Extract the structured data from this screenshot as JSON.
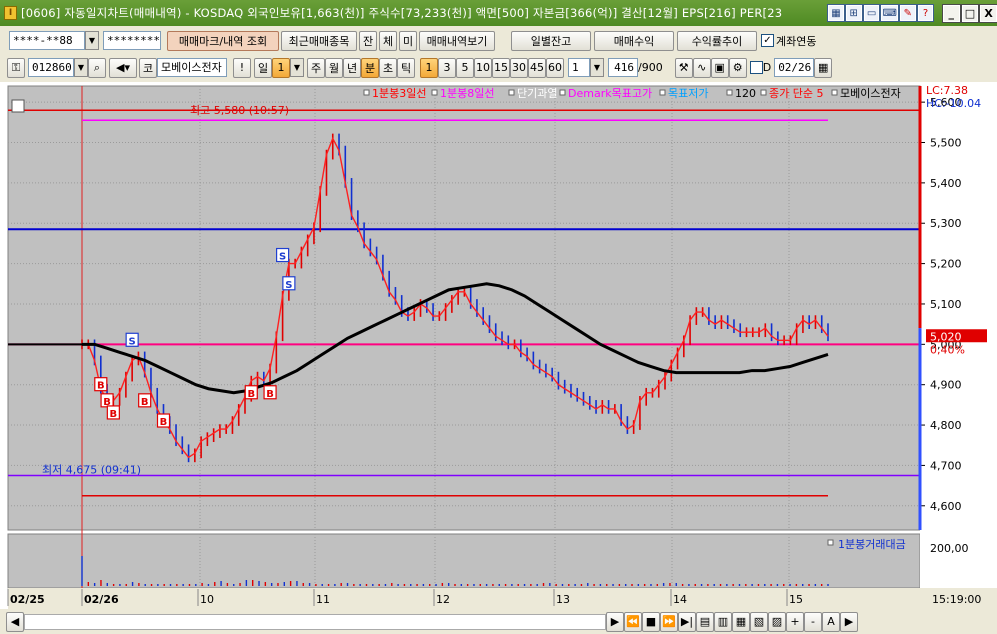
{
  "window": {
    "title": "[0606] 자동일지차트(매매내역) - KOSDAQ 외국인보유[1,663(천)] 주식수[73,233(천)] 액면[500] 자본금[366(억)] 결산[12월] EPS[216] PER[23",
    "app_icon": "I",
    "title_icons": [
      "layout-icon",
      "link-icon",
      "window-icon",
      "keyboard-icon",
      "pen-icon",
      "help-icon"
    ],
    "help_label": "?",
    "minimize_label": "_",
    "maximize_label": "□",
    "close_label": "X"
  },
  "toolbar1": {
    "account": "****-**88",
    "password": "********",
    "trade_mark_button": "매매마크/내역 조회",
    "recent_items_button": "최근매매종목",
    "balance_toggle": "잔",
    "fill_toggle": "체",
    "unfilled_toggle": "미",
    "view_history_button": "매매내역보기",
    "daily_balance_button": "일별잔고",
    "trade_profit_button": "매매수익",
    "return_trend_button": "수익률추이",
    "account_link_label": "계좌연동",
    "account_link_checked": "✓"
  },
  "toolbar2": {
    "stock_code": "012860",
    "market_label": "코",
    "stock_name": "모베이스전자",
    "alert_label": "!",
    "period_day": "일",
    "period_value": "1",
    "period_week": "주",
    "period_month": "월",
    "period_year": "년",
    "period_minute": "분",
    "period_second": "초",
    "period_tick": "틱",
    "intervals": [
      "1",
      "3",
      "5",
      "10",
      "15",
      "30",
      "45",
      "60"
    ],
    "interval_active": "1",
    "interval_custom": "1",
    "count_display": "416",
    "count_total": "/900",
    "d_label": "D",
    "date_value": "02/26"
  },
  "chart_data": {
    "type": "line",
    "subtype": "1-minute candlestick with moving averages",
    "legend": [
      {
        "label": "1분봉3일선",
        "color": "#ff0000"
      },
      {
        "label": "1분봉8일선",
        "color": "#ff00ff"
      },
      {
        "label": "단기과열",
        "color": "#ffffff"
      },
      {
        "label": "Demark목표고가",
        "color": "#ff00ff"
      },
      {
        "label": "목표저가",
        "color": "#00a0ff"
      },
      {
        "label": "120",
        "color": "#000000"
      },
      {
        "label": "종가 단순 5",
        "color": "#ff0000"
      },
      {
        "label": "모베이스전자",
        "color": "#000000"
      }
    ],
    "lc_label": "LC:7.38",
    "hc_label": "HC:-10.04",
    "ylim": [
      4540,
      5640
    ],
    "y_ticks": [
      5600,
      5500,
      5400,
      5300,
      5200,
      5100,
      5000,
      4900,
      4800,
      4700,
      4600
    ],
    "y_tick_labels": [
      "5,600",
      "5,500",
      "5,400",
      "5,300",
      "5,200",
      "5,100",
      "5,000",
      "4,900",
      "4,800",
      "4,700",
      "4,600"
    ],
    "current_price": 5020,
    "current_price_label": "5,020",
    "current_change_label": "0,40%",
    "high_annotation": "최고 5,580 (10:57)",
    "low_annotation": "최저 4,675 (09:41)",
    "lines": {
      "upper_red": 5580,
      "magenta": 5555,
      "blue": 5285,
      "pink": 5000,
      "purple": 4675,
      "lower_red": 4625
    },
    "x_labels": [
      "02/25",
      "02/26",
      "10",
      "11",
      "12",
      "13",
      "14",
      "15"
    ],
    "time_label": "15:19:00",
    "volume_legend": "1분봉거래대금",
    "volume_tick_label": "200,00",
    "price_series": [
      5000,
      5000,
      4960,
      4890,
      4860,
      4860,
      4880,
      4920,
      4960,
      4970,
      4930,
      4880,
      4840,
      4810,
      4790,
      4760,
      4740,
      4720,
      4730,
      4760,
      4770,
      4780,
      4790,
      4790,
      4810,
      4840,
      4870,
      4910,
      4920,
      4910,
      4940,
      5020,
      5120,
      5200,
      5200,
      5230,
      5260,
      5290,
      5380,
      5470,
      5510,
      5480,
      5400,
      5320,
      5290,
      5250,
      5230,
      5210,
      5170,
      5130,
      5110,
      5080,
      5070,
      5080,
      5100,
      5090,
      5070,
      5070,
      5090,
      5110,
      5130,
      5130,
      5100,
      5080,
      5060,
      5040,
      5020,
      5010,
      5000,
      5000,
      4980,
      4970,
      4950,
      4940,
      4930,
      4920,
      4900,
      4890,
      4880,
      4870,
      4860,
      4850,
      4840,
      4850,
      4840,
      4840,
      4810,
      4790,
      4800,
      4860,
      4880,
      4880,
      4900,
      4920,
      4950,
      4980,
      5010,
      5060,
      5080,
      5080,
      5060,
      5050,
      5060,
      5050,
      5040,
      5030,
      5030,
      5030,
      5030,
      5040,
      5020,
      5010,
      5010,
      5010,
      5040,
      5060,
      5050,
      5060,
      5040,
      5020
    ],
    "ma120_series": [
      5000,
      5000,
      4990,
      4980,
      4970,
      4960,
      4945,
      4930,
      4915,
      4900,
      4890,
      4885,
      4880,
      4885,
      4895,
      4905,
      4920,
      4935,
      4955,
      4975,
      4995,
      5015,
      5030,
      5045,
      5060,
      5075,
      5090,
      5105,
      5120,
      5135,
      5140,
      5145,
      5150,
      5145,
      5135,
      5120,
      5100,
      5080,
      5060,
      5040,
      5020,
      5000,
      4985,
      4970,
      4955,
      4945,
      4935,
      4930,
      4930,
      4930,
      4930,
      4930,
      4930,
      4935,
      4935,
      4940,
      4945,
      4955,
      4965,
      4975
    ],
    "markers": [
      {
        "t": "B",
        "i": 3,
        "v": 4900
      },
      {
        "t": "B",
        "i": 4,
        "v": 4860
      },
      {
        "t": "B",
        "i": 5,
        "v": 4830
      },
      {
        "t": "S",
        "i": 8,
        "v": 5010
      },
      {
        "t": "B",
        "i": 10,
        "v": 4860
      },
      {
        "t": "B",
        "i": 13,
        "v": 4810
      },
      {
        "t": "B",
        "i": 27,
        "v": 4880
      },
      {
        "t": "B",
        "i": 30,
        "v": 4880
      },
      {
        "t": "S",
        "i": 32,
        "v": 5220
      },
      {
        "t": "S",
        "i": 33,
        "v": 5150
      }
    ]
  },
  "statusbar": {
    "zoom_in_label": "+",
    "zoom_out_label": "-",
    "font_label": "A",
    "play_label": "▶",
    "stop_label": "■"
  }
}
